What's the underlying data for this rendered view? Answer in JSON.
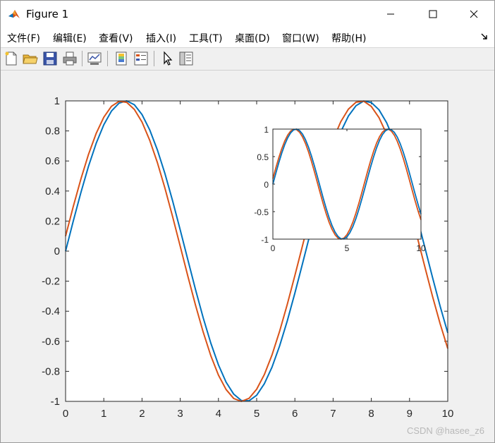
{
  "window": {
    "title": "Figure 1",
    "controls": [
      "minimize",
      "maximize",
      "close"
    ]
  },
  "menubar": {
    "items": [
      {
        "label": "文件(F)"
      },
      {
        "label": "编辑(E)"
      },
      {
        "label": "查看(V)"
      },
      {
        "label": "插入(I)"
      },
      {
        "label": "工具(T)"
      },
      {
        "label": "桌面(D)"
      },
      {
        "label": "窗口(W)"
      },
      {
        "label": "帮助(H)"
      }
    ],
    "dock_icon": "dock-arrow-icon"
  },
  "toolbar": {
    "buttons": [
      {
        "icon": "new-figure-icon"
      },
      {
        "icon": "open-file-icon"
      },
      {
        "icon": "save-icon"
      },
      {
        "icon": "print-icon"
      },
      {
        "icon": "link-plot-icon"
      },
      {
        "icon": "insert-colorbar-icon"
      },
      {
        "icon": "insert-legend-icon"
      },
      {
        "icon": "edit-plot-pointer-icon"
      },
      {
        "icon": "property-inspector-icon"
      }
    ]
  },
  "colors": {
    "series_1": "#0072bd",
    "series_2": "#d95319",
    "axes_background": "#ffffff",
    "figure_background": "#f0f0f0"
  },
  "chart_data": [
    {
      "type": "line",
      "name": "main-axes",
      "title": "",
      "xlabel": "",
      "ylabel": "",
      "xlim": [
        0,
        10
      ],
      "ylim": [
        -1,
        1
      ],
      "xticks": [
        "0",
        "1",
        "2",
        "3",
        "4",
        "5",
        "6",
        "7",
        "8",
        "9",
        "10"
      ],
      "yticks": [
        "-1",
        "-0.8",
        "-0.6",
        "-0.4",
        "-0.2",
        "0",
        "0.2",
        "0.4",
        "0.6",
        "0.8",
        "1"
      ],
      "grid": false,
      "x": [
        0,
        0.2,
        0.4,
        0.6,
        0.8,
        1.0,
        1.2,
        1.4,
        1.6,
        1.8,
        2.0,
        2.2,
        2.4,
        2.6,
        2.8,
        3.0,
        3.2,
        3.4,
        3.6,
        3.8,
        4.0,
        4.2,
        4.4,
        4.6,
        4.8,
        5.0,
        5.2,
        5.4,
        5.6,
        5.8,
        6.0,
        6.2,
        6.4,
        6.6,
        6.8,
        7.0,
        7.2,
        7.4,
        7.6,
        7.8,
        8.0,
        8.2,
        8.4,
        8.6,
        8.8,
        9.0,
        9.2,
        9.4,
        9.6,
        9.8,
        10.0
      ],
      "series": [
        {
          "color": "#0072bd",
          "values": [
            0,
            0.199,
            0.389,
            0.565,
            0.717,
            0.841,
            0.932,
            0.985,
            1.0,
            0.974,
            0.909,
            0.808,
            0.675,
            0.516,
            0.335,
            0.141,
            -0.058,
            -0.256,
            -0.443,
            -0.612,
            -0.757,
            -0.872,
            -0.952,
            -0.994,
            -0.996,
            -0.959,
            -0.883,
            -0.773,
            -0.631,
            -0.465,
            -0.279,
            -0.083,
            0.117,
            0.312,
            0.494,
            0.657,
            0.794,
            0.899,
            0.968,
            0.999,
            0.989,
            0.941,
            0.855,
            0.734,
            0.585,
            0.412,
            0.223,
            0.025,
            -0.174,
            -0.366,
            -0.544
          ]
        },
        {
          "color": "#d95319",
          "values": [
            0.1,
            0.296,
            0.479,
            0.644,
            0.783,
            0.891,
            0.964,
            0.997,
            0.99,
            0.943,
            0.859,
            0.739,
            0.591,
            0.419,
            0.23,
            0.032,
            -0.167,
            -0.36,
            -0.538,
            -0.696,
            -0.825,
            -0.921,
            -0.981,
            -1.0,
            -0.98,
            -0.919,
            -0.822,
            -0.692,
            -0.534,
            -0.355,
            -0.162,
            0.037,
            0.235,
            0.423,
            0.595,
            0.743,
            0.861,
            0.945,
            0.991,
            0.998,
            0.963,
            0.889,
            0.779,
            0.639,
            0.473,
            0.29,
            0.095,
            -0.104,
            -0.3,
            -0.483,
            -0.648
          ]
        }
      ]
    },
    {
      "type": "line",
      "name": "inset-axes",
      "title": "",
      "xlabel": "",
      "ylabel": "",
      "xlim": [
        0,
        10
      ],
      "ylim": [
        -1,
        1
      ],
      "xticks": [
        "0",
        "5",
        "10"
      ],
      "yticks": [
        "-1",
        "-0.5",
        "0",
        "0.5",
        "1"
      ],
      "grid": false,
      "x": [
        0,
        0.2,
        0.4,
        0.6,
        0.8,
        1.0,
        1.2,
        1.4,
        1.6,
        1.8,
        2.0,
        2.2,
        2.4,
        2.6,
        2.8,
        3.0,
        3.2,
        3.4,
        3.6,
        3.8,
        4.0,
        4.2,
        4.4,
        4.6,
        4.8,
        5.0,
        5.2,
        5.4,
        5.6,
        5.8,
        6.0,
        6.2,
        6.4,
        6.6,
        6.8,
        7.0,
        7.2,
        7.4,
        7.6,
        7.8,
        8.0,
        8.2,
        8.4,
        8.6,
        8.8,
        9.0,
        9.2,
        9.4,
        9.6,
        9.8,
        10.0
      ],
      "series": [
        {
          "color": "#d95319",
          "values": [
            0.1,
            0.296,
            0.479,
            0.644,
            0.783,
            0.891,
            0.964,
            0.997,
            0.99,
            0.943,
            0.859,
            0.739,
            0.591,
            0.419,
            0.23,
            0.032,
            -0.167,
            -0.36,
            -0.538,
            -0.696,
            -0.825,
            -0.921,
            -0.981,
            -1.0,
            -0.98,
            -0.919,
            -0.822,
            -0.692,
            -0.534,
            -0.355,
            -0.162,
            0.037,
            0.235,
            0.423,
            0.595,
            0.743,
            0.861,
            0.945,
            0.991,
            0.998,
            0.963,
            0.889,
            0.779,
            0.639,
            0.473,
            0.29,
            0.095,
            -0.104,
            -0.3,
            -0.483,
            -0.648
          ]
        },
        {
          "color": "#0072bd",
          "values": [
            0,
            0.199,
            0.389,
            0.565,
            0.717,
            0.841,
            0.932,
            0.985,
            1.0,
            0.974,
            0.909,
            0.808,
            0.675,
            0.516,
            0.335,
            0.141,
            -0.058,
            -0.256,
            -0.443,
            -0.612,
            -0.757,
            -0.872,
            -0.952,
            -0.994,
            -0.996,
            -0.959,
            -0.883,
            -0.773,
            -0.631,
            -0.465,
            -0.279,
            -0.083,
            0.117,
            0.312,
            0.494,
            0.657,
            0.794,
            0.899,
            0.968,
            0.999,
            0.989,
            0.941,
            0.855,
            0.734,
            0.585,
            0.412,
            0.223,
            0.025,
            -0.174,
            -0.366,
            -0.544
          ]
        }
      ]
    }
  ],
  "watermark": "CSDN @hasee_z6"
}
